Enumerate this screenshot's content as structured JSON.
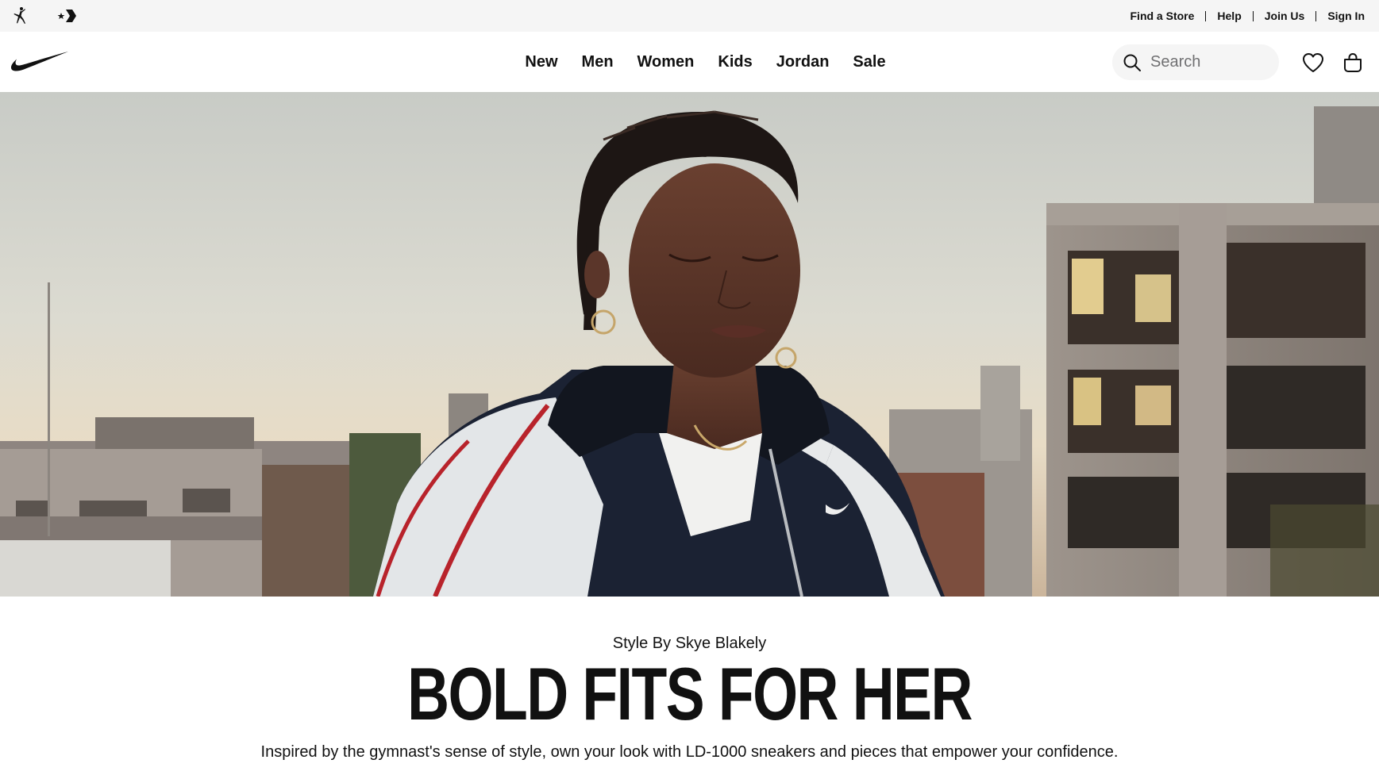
{
  "utility_bar": {
    "brand_icons": [
      "jordan-jumpman-icon",
      "converse-star-chevron-icon"
    ],
    "links": [
      "Find a Store",
      "Help",
      "Join Us",
      "Sign In"
    ]
  },
  "nav": {
    "logo": "nike-swoosh-icon",
    "items": [
      "New",
      "Men",
      "Women",
      "Kids",
      "Jordan",
      "Sale"
    ],
    "search_placeholder": "Search",
    "search_icon": "search-icon",
    "favorites_icon": "heart-icon",
    "bag_icon": "bag-icon"
  },
  "hero": {
    "eyebrow": "Style By Skye Blakely",
    "headline": "BOLD FITS FOR HER",
    "subcopy": "Inspired by the gymnast's sense of style, own your look with LD-1000 sneakers and pieces that empower your confidence."
  },
  "colors": {
    "utility_bg": "#f5f5f5",
    "text": "#111111",
    "search_bg": "#f5f5f5"
  }
}
